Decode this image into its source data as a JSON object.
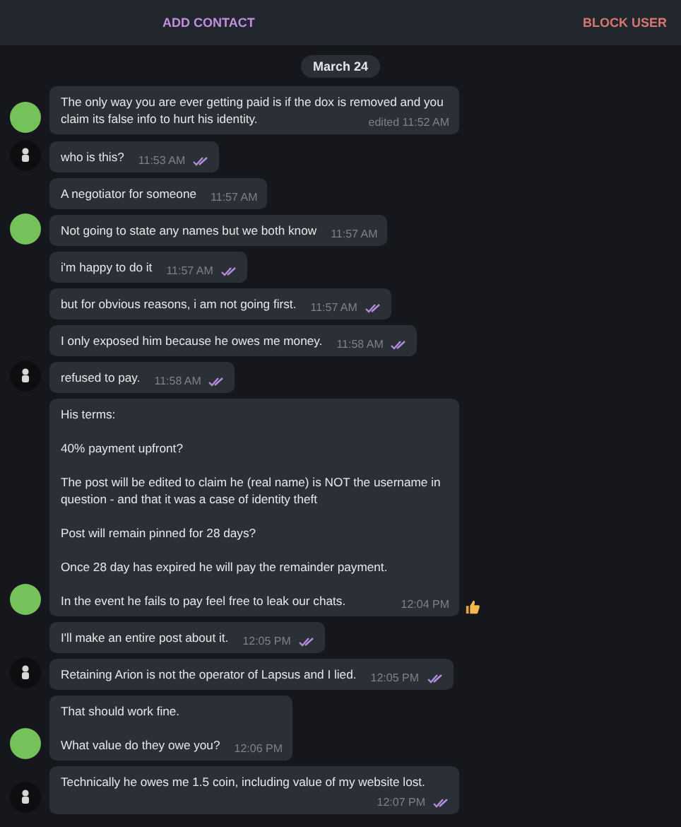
{
  "header": {
    "add_contact": "ADD CONTACT",
    "block_user": "BLOCK USER"
  },
  "date": "March 24",
  "groups": [
    {
      "kind": "contact",
      "messages": [
        {
          "paragraphs": [
            "The only way you are ever getting paid is if the dox is removed and you claim its false info to hurt his identity."
          ],
          "time": "edited 11:52 AM"
        }
      ]
    },
    {
      "kind": "self",
      "messages": [
        {
          "paragraphs": [
            "who is this?"
          ],
          "time": "11:53 AM",
          "read": true
        }
      ]
    },
    {
      "kind": "contact",
      "messages": [
        {
          "paragraphs": [
            "A negotiator for someone"
          ],
          "time": "11:57 AM"
        },
        {
          "paragraphs": [
            "Not going to state any names but we both know"
          ],
          "time": "11:57 AM"
        }
      ]
    },
    {
      "kind": "self",
      "messages": [
        {
          "paragraphs": [
            "i'm happy to do it"
          ],
          "time": "11:57 AM",
          "read": true
        },
        {
          "paragraphs": [
            "but for obvious reasons, i am not going first."
          ],
          "time": "11:57 AM",
          "read": true
        },
        {
          "paragraphs": [
            "I only exposed him because he owes me money."
          ],
          "time": "11:58 AM",
          "read": true
        },
        {
          "paragraphs": [
            "refused to pay."
          ],
          "time": "11:58 AM",
          "read": true
        }
      ]
    },
    {
      "kind": "contact",
      "messages": [
        {
          "paragraphs": [
            "His terms:",
            "40% payment upfront?",
            "The post will be edited to claim he (real name) is NOT the username in question - and that it was a case of identity theft",
            "Post will remain pinned for 28 days?",
            "Once 28 day has expired he will pay the remainder payment.",
            "In the event he fails to pay feel free to leak our chats."
          ],
          "time": "12:04 PM",
          "reacted": true
        }
      ]
    },
    {
      "kind": "self",
      "messages": [
        {
          "paragraphs": [
            "I'll make an entire post about it."
          ],
          "time": "12:05 PM",
          "read": true
        },
        {
          "paragraphs": [
            "Retaining Arion is not the operator of Lapsus and I lied."
          ],
          "time": "12:05 PM",
          "read": true
        }
      ]
    },
    {
      "kind": "contact",
      "messages": [
        {
          "paragraphs": [
            "That should work fine.",
            "What value do they owe you?"
          ],
          "time": "12:06 PM"
        }
      ]
    },
    {
      "kind": "self",
      "messages": [
        {
          "paragraphs": [
            "Technically he owes me 1.5 coin, including value of my website lost."
          ],
          "time": "12:07 PM",
          "read": true
        }
      ]
    }
  ]
}
